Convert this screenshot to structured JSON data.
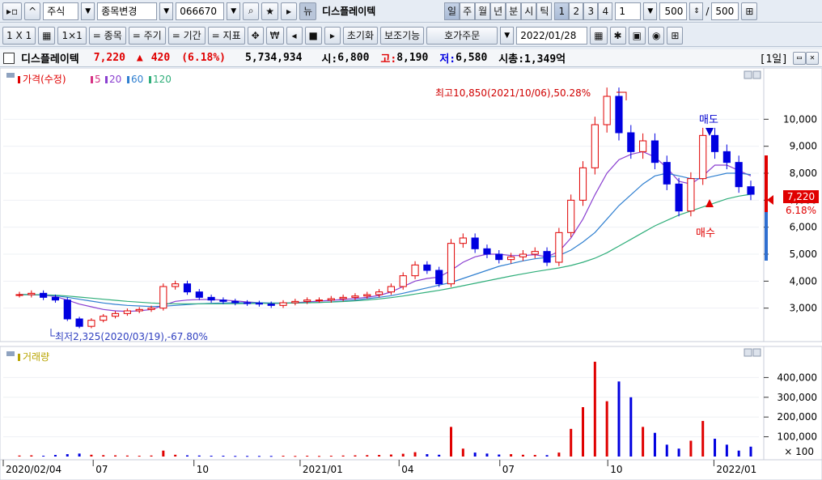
{
  "toolbar1": {
    "market": "주식",
    "change_label": "종목변경",
    "code": "066670",
    "news_label": "뉴",
    "stock_name": "디스플레이텍",
    "periods": [
      "일",
      "주",
      "월",
      "년",
      "분",
      "시",
      "틱"
    ],
    "numbers": [
      "1",
      "2",
      "3",
      "4"
    ],
    "interval_value": "1",
    "count_value": "500",
    "count_total": "500",
    "slash": "/"
  },
  "toolbar2": {
    "layout_label": "1 X 1",
    "grid_label": "1×1",
    "stock_label": "= 종목",
    "cycle_label": "= 주기",
    "period_label": "= 기간",
    "indicator_label": "= 지표",
    "currency_label": "₩",
    "reset_label": "초기화",
    "aux_label": "보조기능",
    "order_label": "호가주문",
    "date_value": "2022/01/28"
  },
  "titlebar": {
    "name": "디스플레이텍",
    "price": "7,220",
    "arrow": "▲",
    "change": "420",
    "change_pct": "(6.18%)",
    "volume": "5,734,934",
    "open_label": "시:",
    "open": "6,800",
    "high_label": "고:",
    "high": "8,190",
    "low_label": "저:",
    "low": "6,580",
    "cap_label": "시총:",
    "cap": "1,349억",
    "period_tag": "[1일]"
  },
  "legend": {
    "price": "가격(수정)",
    "ma": [
      "5",
      "20",
      "60",
      "120"
    ],
    "volume": "거래량"
  },
  "annotations": {
    "high": "최고10,850(2021/10/06),50.28%",
    "low": "최저2,325(2020/03/19),-67.80%",
    "sell": "매도",
    "buy": "매수"
  },
  "price_box": {
    "value": "7,220",
    "pct": "6.18%"
  },
  "colors": {
    "up": "#e00000",
    "down": "#0000e0",
    "ma5": "#d63384",
    "ma20": "#8a3fd0",
    "ma60": "#2f7fd0",
    "ma120": "#2fae7a",
    "volume_legend": "#b8a400"
  },
  "chart_data": [
    {
      "type": "candlestick",
      "title": "디스플레이텍",
      "y_ticks": [
        3000,
        4000,
        5000,
        6000,
        7000,
        8000,
        9000,
        10000
      ],
      "y_tick_labels": [
        "3,000",
        "4,000",
        "5,000",
        "6,000",
        "7,000",
        "8,000",
        "9,000",
        "10,000"
      ],
      "x_ticks": [
        "2020/02/04",
        "07",
        "10",
        "2021/01",
        "04",
        "07",
        "10",
        "2022/01"
      ],
      "x_tick_index": [
        0,
        50,
        106,
        165,
        220,
        276,
        336,
        395
      ],
      "ylim": [
        2000,
        11000
      ],
      "close_series": [
        3500,
        3550,
        3400,
        3300,
        2600,
        2325,
        2550,
        2700,
        2800,
        2900,
        2950,
        3000,
        3800,
        3900,
        3600,
        3400,
        3300,
        3250,
        3200,
        3180,
        3150,
        3100,
        3200,
        3250,
        3300,
        3300,
        3350,
        3400,
        3450,
        3500,
        3600,
        3800,
        4200,
        4600,
        4400,
        3900,
        5400,
        5600,
        5200,
        5000,
        4800,
        4900,
        5000,
        5100,
        4700,
        5800,
        7000,
        8200,
        9800,
        10850,
        9500,
        8800,
        9200,
        8400,
        7600,
        6600,
        7800,
        9400,
        8800,
        8400,
        7500,
        7220
      ],
      "ma20_series": [
        3500,
        3500,
        3480,
        3430,
        3300,
        3150,
        3050,
        2950,
        2900,
        2880,
        2900,
        2950,
        3100,
        3250,
        3300,
        3320,
        3320,
        3300,
        3270,
        3230,
        3200,
        3170,
        3180,
        3200,
        3230,
        3260,
        3290,
        3320,
        3360,
        3400,
        3470,
        3600,
        3800,
        4000,
        4100,
        4150,
        4400,
        4700,
        4900,
        5000,
        5000,
        4950,
        4950,
        4980,
        4900,
        5100,
        5600,
        6300,
        7200,
        8000,
        8500,
        8700,
        8800,
        8600,
        8200,
        7700,
        7600,
        7900,
        8300,
        8300,
        8100,
        7900
      ],
      "ma60_series": [
        3500,
        3500,
        3490,
        3460,
        3400,
        3330,
        3260,
        3190,
        3140,
        3100,
        3080,
        3060,
        3070,
        3100,
        3130,
        3160,
        3180,
        3190,
        3200,
        3200,
        3200,
        3190,
        3190,
        3190,
        3200,
        3210,
        3230,
        3260,
        3300,
        3350,
        3400,
        3460,
        3550,
        3650,
        3750,
        3850,
        3950,
        4100,
        4250,
        4400,
        4550,
        4650,
        4750,
        4830,
        4880,
        4950,
        5150,
        5450,
        5800,
        6300,
        6800,
        7200,
        7600,
        7900,
        8000,
        7900,
        7800,
        7800,
        7900,
        8000,
        8000,
        7950
      ],
      "ma120_series": [
        3500,
        3500,
        3495,
        3480,
        3450,
        3410,
        3370,
        3330,
        3290,
        3250,
        3220,
        3190,
        3170,
        3160,
        3160,
        3160,
        3160,
        3160,
        3165,
        3170,
        3175,
        3180,
        3185,
        3190,
        3200,
        3210,
        3225,
        3245,
        3270,
        3300,
        3340,
        3390,
        3450,
        3520,
        3590,
        3660,
        3740,
        3830,
        3920,
        4010,
        4100,
        4190,
        4270,
        4350,
        4420,
        4490,
        4580,
        4700,
        4850,
        5050,
        5300,
        5550,
        5800,
        6050,
        6250,
        6450,
        6600,
        6750,
        6900,
        7050,
        7150,
        7220
      ],
      "volume_ylim": [
        0,
        500000
      ],
      "volume_ticks": [
        "100,000",
        "200,000",
        "300,000",
        "400,000"
      ],
      "volume_unit": "× 100",
      "volume_series": [
        5000,
        6000,
        4000,
        8000,
        12000,
        15000,
        9000,
        7000,
        6000,
        5000,
        4000,
        5000,
        30000,
        9000,
        6000,
        5000,
        4000,
        4000,
        3000,
        3000,
        3000,
        3000,
        4000,
        3000,
        4000,
        3000,
        4000,
        5000,
        6000,
        7000,
        8000,
        10000,
        14000,
        22000,
        12000,
        9000,
        150000,
        40000,
        20000,
        15000,
        10000,
        12000,
        9000,
        8000,
        7000,
        20000,
        140000,
        250000,
        480000,
        280000,
        380000,
        300000,
        150000,
        120000,
        60000,
        40000,
        80000,
        180000,
        90000,
        60000,
        30000,
        50000
      ]
    }
  ]
}
